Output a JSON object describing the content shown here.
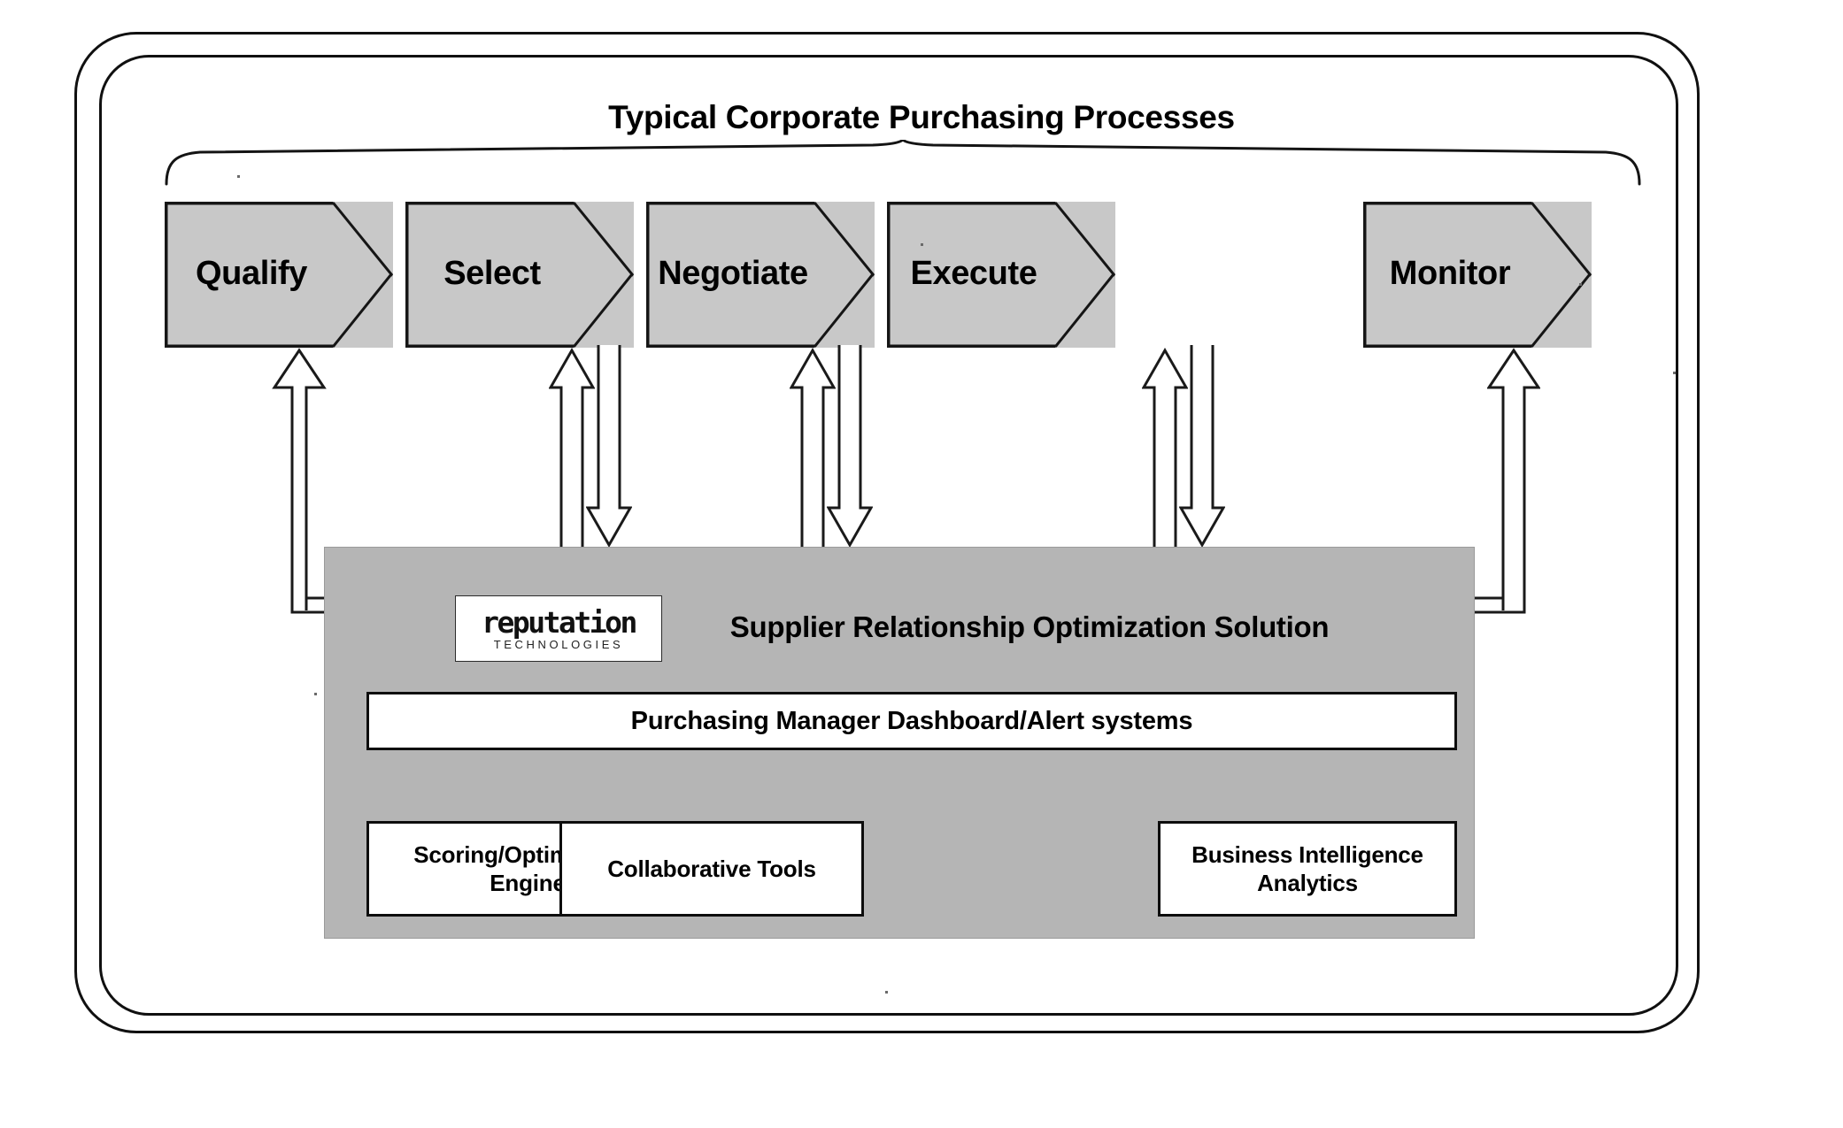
{
  "diagram": {
    "title": "Typical Corporate Purchasing Processes",
    "process_steps": [
      {
        "label": "Qualify"
      },
      {
        "label": "Select"
      },
      {
        "label": "Negotiate"
      },
      {
        "label": "Execute"
      },
      {
        "label": "Monitor"
      }
    ],
    "solution_panel": {
      "heading": "Supplier Relationship Optimization Solution",
      "logo": {
        "wordmark": "reputation",
        "tagline": "TECHNOLOGIES"
      },
      "dashboard": "Purchasing Manager Dashboard/Alert systems",
      "components": [
        {
          "label": "Scoring/Optimization Engine"
        },
        {
          "label": "Collaborative Tools"
        },
        {
          "label": "Business Intelligence Analytics"
        }
      ]
    },
    "colors": {
      "chevron_fill": "#c8c8c8",
      "panel_fill": "#b5b5b5",
      "stroke": "#101010",
      "box_fill": "#ffffff"
    }
  }
}
